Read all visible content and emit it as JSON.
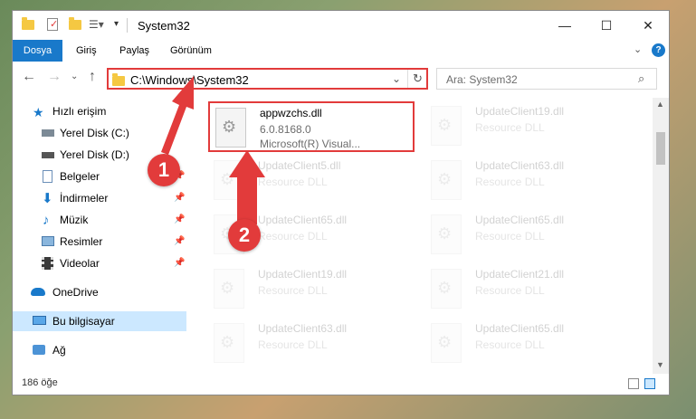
{
  "window": {
    "title": "System32"
  },
  "tabs": [
    "Dosya",
    "Giriş",
    "Paylaş",
    "Görünüm"
  ],
  "nav": {
    "address": "C:\\Windows\\System32",
    "search_placeholder": "Ara: System32"
  },
  "sidebar": {
    "items": [
      {
        "label": "Hızlı erişim",
        "icon": "star-icon"
      },
      {
        "label": "Yerel Disk (C:)",
        "icon": "drive-icon"
      },
      {
        "label": "Yerel Disk (D:)",
        "icon": "drive-icon"
      },
      {
        "label": "Belgeler",
        "icon": "document-icon"
      },
      {
        "label": "İndirmeler",
        "icon": "download-icon"
      },
      {
        "label": "Müzik",
        "icon": "music-icon"
      },
      {
        "label": "Resimler",
        "icon": "pictures-icon"
      },
      {
        "label": "Videolar",
        "icon": "video-icon"
      },
      {
        "label": "OneDrive",
        "icon": "cloud-icon"
      },
      {
        "label": "Bu bilgisayar",
        "icon": "computer-icon"
      },
      {
        "label": "Ağ",
        "icon": "network-icon"
      }
    ]
  },
  "files": [
    {
      "name": "appwzchs.dll",
      "line2": "6.0.8168.0",
      "line3": "Microsoft(R) Visual..."
    },
    {
      "name": "UpdateClient19.dll",
      "line2": "Resource DLL"
    },
    {
      "name": "UpdateClient5.dll",
      "line2": "Resource DLL"
    },
    {
      "name": "UpdateClient63.dll",
      "line2": "Resource DLL"
    },
    {
      "name": "UpdateClient65.dll",
      "line2": "Resource DLL"
    },
    {
      "name": "UpdateClient65.dll",
      "line2": "Resource DLL"
    },
    {
      "name": "UpdateClient19.dll",
      "line2": "Resource DLL"
    },
    {
      "name": "UpdateClient21.dll",
      "line2": "Resource DLL"
    },
    {
      "name": "UpdateClient63.dll",
      "line2": "Resource DLL"
    },
    {
      "name": "UpdateClient65.dll",
      "line2": "Resource DLL"
    }
  ],
  "status": {
    "count": "186 öğe"
  },
  "annotations": {
    "step1": "1",
    "step2": "2",
    "color": "#e23b3b"
  }
}
